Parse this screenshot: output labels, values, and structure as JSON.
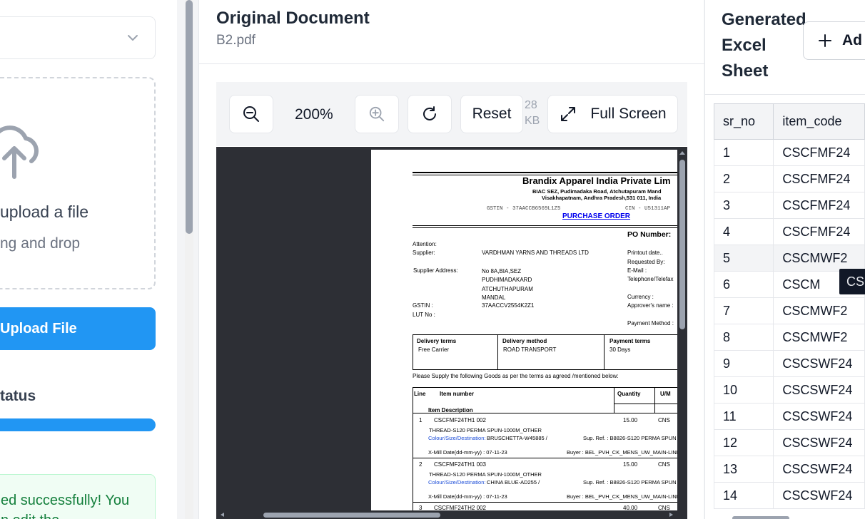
{
  "left": {
    "upload_title": "upload a file",
    "upload_sub": "ng and drop",
    "upload_button": "Upload File",
    "status_label": "tatus",
    "progress_fraction": 1.0,
    "success_line1": "ed successfully! You",
    "success_line2": "n edit the"
  },
  "middle": {
    "title": "Original Document",
    "filename": "B2.pdf",
    "zoom_level": "200%",
    "reset_label": "Reset",
    "file_size_line1": "28",
    "file_size_line2": "KB",
    "fullscreen_label": "Full Screen"
  },
  "pdf": {
    "company": "Brandix Apparel India Private Lim",
    "address1": "BIAC SEZ, Pudimadaka Road, Atchutapuram Mand",
    "address2": "Visakhapatnam, Andhra Pradesh,531 011, India",
    "gstin_line": "GSTIN - 37AACCB6569L1Z5",
    "cin_line": "CIN - U51311AP",
    "heading": "PURCHASE ORDER",
    "po_number_label": "PO Number:",
    "attention": "Attention:",
    "supplier_label": "Supplier:",
    "supplier_value": "VARDHMAN YARNS AND THREADS LTD",
    "supplier_address_label": "Supplier Address:",
    "address_lines": [
      "No 8A,BIA,SEZ",
      "PUDHIMADAKARD",
      "ATCHUTHAPURAM",
      "MANDAL"
    ],
    "gstin_label": "GSTIN :",
    "gstin_value": "37AACCV2554K2Z1",
    "lut_label": "LUT No :",
    "right_labels": [
      "Printout date..",
      "Requested By:",
      "E-Mail :",
      "Telephone/Telefax",
      "Currency :",
      "Approver's name :",
      "Payment Method :"
    ],
    "delivery_terms_label": "Delivery terms",
    "delivery_terms_value": "Free Carrier",
    "delivery_method_label": "Delivery method",
    "delivery_method_value": "ROAD TRANSPORT",
    "payment_terms_label": "Payment terms",
    "payment_terms_value": "30 Days",
    "supply_note": "Please Supply the following Goods as per the terms as agreed /mentioned below:",
    "col_line": "Line",
    "col_item": "Item number",
    "col_qty": "Quantity",
    "col_um": "U/M",
    "col_desc": "Item Description",
    "items": [
      {
        "line": "1",
        "code": "CSCFMF24TH1 002",
        "qty": "15.00",
        "um": "CNS",
        "desc": "THREAD-S120 PERMA SPUN-1000M_OTHER",
        "colour_label": "Colour/Size/Destination:",
        "colour": "BRUSCHETTA-W45885 /",
        "supref": "Sup. Ref. : B8826-S120 PERMA SPUN",
        "xmill": "X-Mill Date(dd-mm-yy) :  07-11-23",
        "buyer": "Buyer : BEL_PVH_CK_MENS_UW_MAIN-LINE"
      },
      {
        "line": "2",
        "code": "CSCFMF24TH1 003",
        "qty": "15.00",
        "um": "CNS",
        "desc": "THREAD-S120 PERMA SPUN-1000M_OTHER",
        "colour_label": "Colour/Size/Destination:",
        "colour": "CHINA BLUE-AD255 /",
        "supref": "Sup. Ref. : B8826-S120 PERMA SPUN",
        "xmill": "X-Mill Date(dd-mm-yy) :  07-11-23",
        "buyer": "Buyer : BEL_PVH_CK_MENS_UW_MAIN-LINE"
      },
      {
        "line": "3",
        "code": "CSCFMF24TH2 002",
        "qty": "40.00",
        "um": "CNS"
      }
    ]
  },
  "right": {
    "title": "Generated Excel Sheet",
    "add_label": "Ad",
    "columns": [
      "sr_no",
      "item_code"
    ],
    "rows": [
      [
        "1",
        "CSCFMF24"
      ],
      [
        "2",
        "CSCFMF24"
      ],
      [
        "3",
        "CSCFMF24"
      ],
      [
        "4",
        "CSCFMF24"
      ],
      [
        "5",
        "CSCMWF2"
      ],
      [
        "6",
        "CSCM"
      ],
      [
        "7",
        "CSCMWF2"
      ],
      [
        "8",
        "CSCMWF2"
      ],
      [
        "9",
        "CSCSWF24"
      ],
      [
        "10",
        "CSCSWF24"
      ],
      [
        "11",
        "CSCSWF24"
      ],
      [
        "12",
        "CSCSWF24"
      ],
      [
        "13",
        "CSCSWF24"
      ],
      [
        "14",
        "CSCSWF24"
      ]
    ],
    "highlight_row": 4,
    "tooltip": "CSC"
  }
}
